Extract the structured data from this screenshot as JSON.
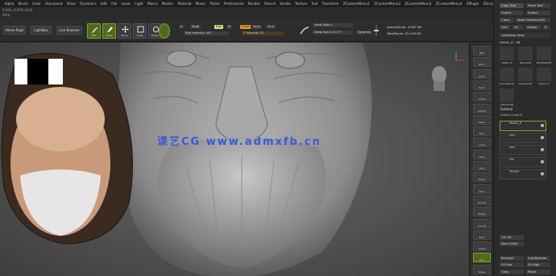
{
  "menu": [
    "Alpha",
    "Brush",
    "Color",
    "Document",
    "Draw",
    "Dynamics",
    "Edit",
    "File",
    "Layer",
    "Light",
    "Macro",
    "Marker",
    "Material",
    "Movie",
    "Picker",
    "Preferences",
    "Render",
    "Stencil",
    "Stroke",
    "Texture",
    "Tool",
    "Transform",
    "ZCustomMenu1",
    "ZCustomMenu2",
    "ZCustomMenu3",
    "ZCustomMenu4",
    "ZPlugin",
    "ZScript"
  ],
  "status": {
    "coords": "0.041,-0.476,-0.04",
    "help": "Help"
  },
  "toolbar": {
    "home": "Home Page",
    "lightbox": "LightBox",
    "live_boolean": "Live Boolean",
    "edit": "Edit",
    "draw": "Draw",
    "move": "Move",
    "scale": "Scale",
    "rotate": "Rotate",
    "a_label": "A",
    "mrgb": "Mrgb",
    "rgb": "Rgb",
    "m": "M",
    "zadd": "Zadd",
    "zsub": "Zsub",
    "zcut": "Zcut",
    "rgb_intensity": "Rgb Intensity 100",
    "z_intensity": "Z Intensity 25",
    "focal_shift": "Focal Shift 0",
    "draw_size": "Draw Size 0.11177",
    "dynamic": "Dynamic",
    "active_points": "ActivePoints: 4.087 Mil",
    "total_points": "TotalPoints: 25.199 Mil"
  },
  "viewport": {
    "watermark": "课艺CG  www.admxfb.cn"
  },
  "toolcol": [
    "BPR",
    "SPix 3",
    "Scroll",
    "Zoom",
    "Actual",
    "AAHalf",
    "Persp",
    "Floor",
    "Local",
    "LSym",
    "Gxyz",
    "Frame",
    "Move",
    "ZoomD",
    "Rotate",
    "Line Fill",
    "PolyF",
    "Transp",
    "Solo",
    "Xpose"
  ],
  "rpanel": {
    "copy_tool": "Copy Tool",
    "paste_tool": "Paste Tool",
    "import": "Import",
    "export": "Export",
    "clone": "Clone",
    "make_polymesh": "Make PolyMesh3D",
    "goz": "GoZ",
    "all": "All",
    "visible": "Visible",
    "r": "R",
    "lightbox_tools": "Lightbox▸ Tools",
    "head_title": "Head1_8 . 48",
    "tools": [
      "Head1_8",
      "Sphere3D",
      "PolyMesh3D",
      "SimpleBrush",
      "Cylinder3D",
      "Head1_8",
      "Cylinder3D"
    ],
    "subtool": "Subtool",
    "visible_count": "Visible Count 8",
    "subtools": [
      "Head1_8",
      "Hair",
      "Hair",
      "Top",
      "Temple"
    ],
    "list_all": "List All",
    "new_folder": "New Folder",
    "rename": "Rename",
    "autoreorder": "AutoReorder",
    "all_low": "All Low",
    "all_high": "All High",
    "copy": "Copy",
    "paste": "Paste"
  },
  "colors": {
    "accent": "#7ea82e",
    "orange": "#e39a2e",
    "panel": "#2b2b2b",
    "bg": "#2a2a2a"
  }
}
